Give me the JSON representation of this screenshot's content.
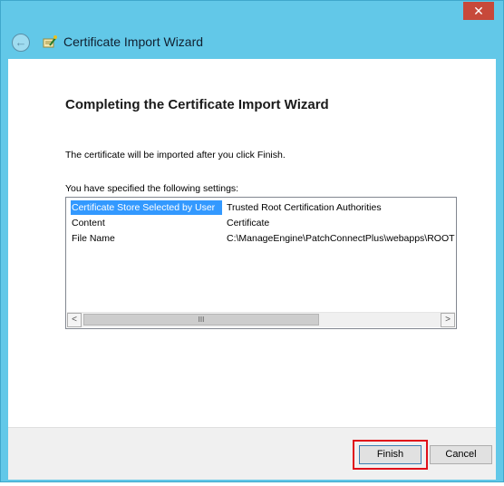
{
  "window": {
    "title": "Certificate Import Wizard",
    "close_glyph": "✕",
    "back_glyph": "←"
  },
  "page": {
    "heading": "Completing the Certificate Import Wizard",
    "description": "The certificate will be imported after you click Finish.",
    "settings_label": "You have specified the following settings:"
  },
  "settings": [
    {
      "key": "Certificate Store Selected by User",
      "value": "Trusted Root Certification Authorities",
      "selected": true
    },
    {
      "key": "Content",
      "value": "Certificate",
      "selected": false
    },
    {
      "key": "File Name",
      "value": "C:\\ManageEngine\\PatchConnectPlus\\webapps\\ROOT",
      "selected": false
    }
  ],
  "scrollbar": {
    "left_arrow": "<",
    "right_arrow": ">",
    "thumb_grip": "III"
  },
  "buttons": {
    "finish": "Finish",
    "cancel": "Cancel"
  },
  "colors": {
    "frame": "#62c8e8",
    "selection": "#3399ff",
    "highlight_box": "#e0101a",
    "close_button": "#c7493a"
  }
}
